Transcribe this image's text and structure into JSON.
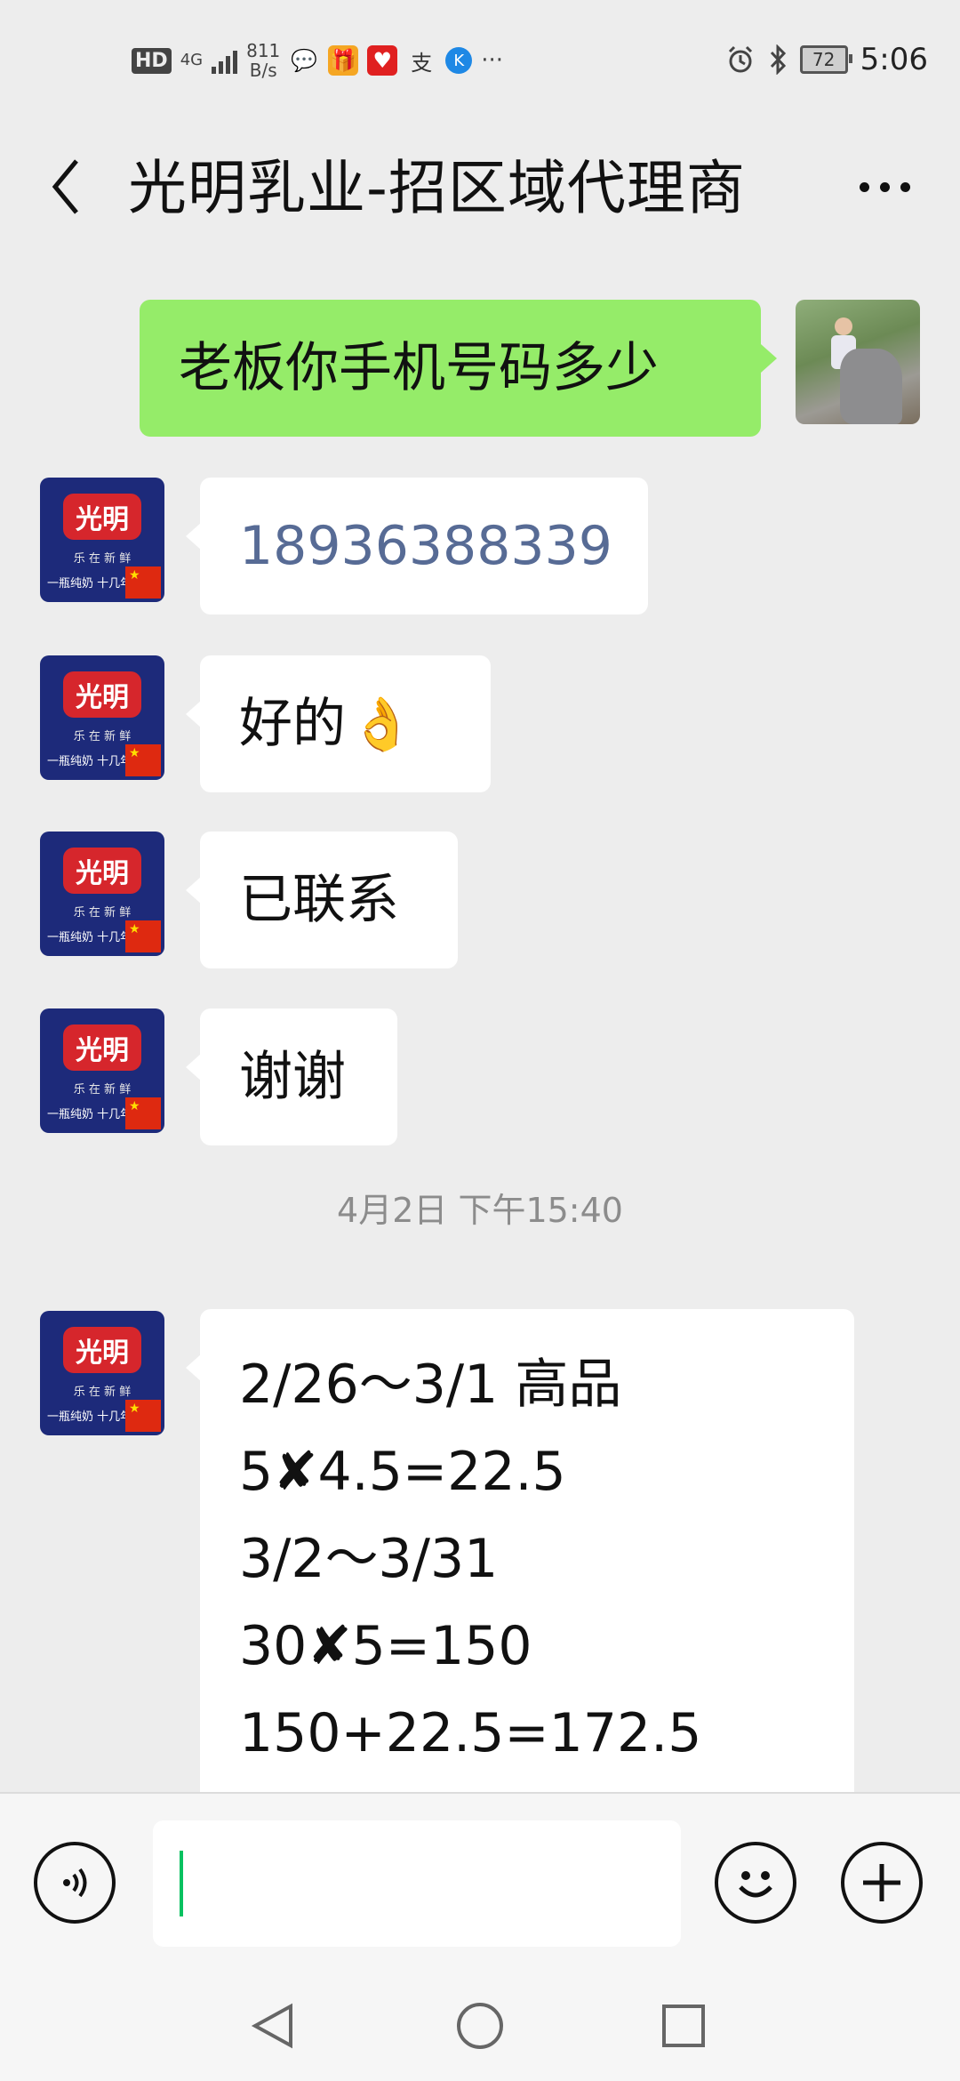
{
  "status_bar": {
    "hd": "HD",
    "network": "4G",
    "speed_value": "811",
    "speed_unit": "B/s",
    "battery": "72",
    "time": "5:06"
  },
  "header": {
    "title": "光明乳业-招区域代理商"
  },
  "messages": [
    {
      "side": "out",
      "text": "老板你手机号码多少"
    },
    {
      "side": "in",
      "text": "18936388339"
    },
    {
      "side": "in",
      "text": "好的",
      "emoji": "👌"
    },
    {
      "side": "in",
      "text": "已联系"
    },
    {
      "side": "in",
      "text": "谢谢"
    }
  ],
  "timestamp": "4月2日 下午15:40",
  "long_message": {
    "lines": [
      "2/26～3/1  高品",
      "5✘4.5=22.5",
      "3/2～3/31",
      "30✘5=150",
      "150+22.5=172.5"
    ]
  },
  "brand_avatar": {
    "logo": "光明",
    "slogan": "乐 在 新 鲜",
    "sub": "一瓶纯奶 十几年"
  },
  "input": {
    "value": "",
    "placeholder": ""
  },
  "colors": {
    "outgoing_bubble": "#95ec69",
    "incoming_bubble": "#ffffff",
    "background": "#ededed",
    "link": "#576b95",
    "caret": "#07c160"
  }
}
